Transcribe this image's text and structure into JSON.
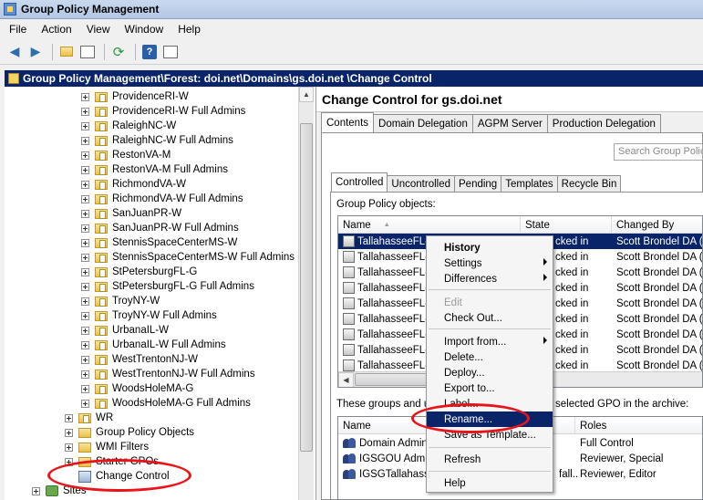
{
  "window": {
    "title": "Group Policy Management"
  },
  "menubar": [
    "File",
    "Action",
    "View",
    "Window",
    "Help"
  ],
  "toolbar": {
    "icons": [
      "back-arrow-icon",
      "forward-arrow-icon",
      "up-folder-icon",
      "show-hide-tree-icon",
      "refresh-icon",
      "help-icon",
      "properties-icon"
    ]
  },
  "path": "Group Policy Management\\Forest: doi.net\\Domains\\gs.doi.net \\Change Control",
  "tree": {
    "items": [
      {
        "label": "ProvidenceRI-W",
        "level": 2,
        "icon": "folder"
      },
      {
        "label": "ProvidenceRI-W Full Admins",
        "level": 2,
        "icon": "folder"
      },
      {
        "label": "RaleighNC-W",
        "level": 2,
        "icon": "folder"
      },
      {
        "label": "RaleighNC-W Full Admins",
        "level": 2,
        "icon": "folder"
      },
      {
        "label": "RestonVA-M",
        "level": 2,
        "icon": "folder"
      },
      {
        "label": "RestonVA-M Full Admins",
        "level": 2,
        "icon": "folder"
      },
      {
        "label": "RichmondVA-W",
        "level": 2,
        "icon": "folder"
      },
      {
        "label": "RichmondVA-W Full Admins",
        "level": 2,
        "icon": "folder"
      },
      {
        "label": "SanJuanPR-W",
        "level": 2,
        "icon": "folder"
      },
      {
        "label": "SanJuanPR-W Full Admins",
        "level": 2,
        "icon": "folder"
      },
      {
        "label": "StennisSpaceCenterMS-W",
        "level": 2,
        "icon": "folder"
      },
      {
        "label": "StennisSpaceCenterMS-W Full Admins",
        "level": 2,
        "icon": "folder"
      },
      {
        "label": "StPetersburgFL-G",
        "level": 2,
        "icon": "folder"
      },
      {
        "label": "StPetersburgFL-G Full Admins",
        "level": 2,
        "icon": "folder"
      },
      {
        "label": "TroyNY-W",
        "level": 2,
        "icon": "folder"
      },
      {
        "label": "TroyNY-W Full Admins",
        "level": 2,
        "icon": "folder"
      },
      {
        "label": "UrbanaIL-W",
        "level": 2,
        "icon": "folder"
      },
      {
        "label": "UrbanaIL-W Full Admins",
        "level": 2,
        "icon": "folder"
      },
      {
        "label": "WestTrentonNJ-W",
        "level": 2,
        "icon": "folder"
      },
      {
        "label": "WestTrentonNJ-W Full Admins",
        "level": 2,
        "icon": "folder"
      },
      {
        "label": "WoodsHoleMA-G",
        "level": 2,
        "icon": "folder"
      },
      {
        "label": "WoodsHoleMA-G Full Admins",
        "level": 2,
        "icon": "folder"
      },
      {
        "label": "WR",
        "level": 1,
        "icon": "folder"
      },
      {
        "label": "Group Policy Objects",
        "level": 1,
        "icon": "folder"
      },
      {
        "label": "WMI Filters",
        "level": 1,
        "icon": "folder"
      },
      {
        "label": "Starter GPOs",
        "level": 1,
        "icon": "folder"
      },
      {
        "label": "Change Control",
        "level": 1,
        "icon": "change-control"
      },
      {
        "label": "Sites",
        "level": 0,
        "icon": "sites"
      }
    ]
  },
  "right": {
    "header": "Change Control for gs.doi.net",
    "tabs": [
      "Contents",
      "Domain Delegation",
      "AGPM Server",
      "Production Delegation"
    ],
    "search_placeholder": "Search Group Policy",
    "subtabs": [
      "Controlled",
      "Uncontrolled",
      "Pending",
      "Templates",
      "Recycle Bin"
    ],
    "gpo_label": "Group Policy objects:",
    "gpo_columns": [
      "Name",
      "State",
      "Changed By"
    ],
    "gpo_rows": [
      {
        "name": "TallahasseeFL-S",
        "state": "cked in",
        "changed_by": "Scott Brondel DA (s"
      },
      {
        "name": "TallahasseeFL-S",
        "state": "cked in",
        "changed_by": "Scott Brondel DA (s"
      },
      {
        "name": "TallahasseeFL-S",
        "state": "cked in",
        "changed_by": "Scott Brondel DA (s"
      },
      {
        "name": "TallahasseeFL-S",
        "state": "cked in",
        "changed_by": "Scott Brondel DA (s"
      },
      {
        "name": "TallahasseeFL-S",
        "state": "cked in",
        "changed_by": "Scott Brondel DA (s"
      },
      {
        "name": "TallahasseeFL-S",
        "state": "cked in",
        "changed_by": "Scott Brondel DA (s"
      },
      {
        "name": "TallahasseeFL-S",
        "state": "cked in",
        "changed_by": "Scott Brondel DA (s"
      },
      {
        "name": "TallahasseeFL-S",
        "state": "cked in",
        "changed_by": "Scott Brondel DA (s"
      },
      {
        "name": "TallahasseeFL-S",
        "state": "cked in",
        "changed_by": "Scott Brondel DA (s"
      }
    ],
    "groups_label_left": "These groups and us",
    "groups_label_right": "selected GPO in the archive:",
    "groups_columns": [
      "Name",
      "Roles"
    ],
    "groups_rows": [
      {
        "name": "Domain Admins",
        "mid": "",
        "role": "Full Control"
      },
      {
        "name": "IGSGOU Admins",
        "mid": "",
        "role": "Reviewer, Special"
      },
      {
        "name": "IGSGTallahasse",
        "mid": "fall...",
        "role": "Reviewer, Editor"
      }
    ]
  },
  "context_menu": {
    "items": [
      {
        "label": "History",
        "style": "bold"
      },
      {
        "label": "Settings",
        "submenu": true
      },
      {
        "label": "Differences",
        "submenu": true
      },
      {
        "label": "Edit",
        "style": "disabled"
      },
      {
        "label": "Check Out..."
      },
      {
        "label": "Import from...",
        "submenu": true
      },
      {
        "label": "Delete..."
      },
      {
        "label": "Deploy..."
      },
      {
        "label": "Export to..."
      },
      {
        "label": "Label..."
      },
      {
        "label": "Rename...",
        "style": "highlight"
      },
      {
        "label": "Save as Template..."
      },
      {
        "label": "Refresh"
      },
      {
        "label": "Help"
      }
    ]
  },
  "colors": {
    "selection": "#0a246a",
    "annotation": "#e8141a",
    "folder": "#f0cf6a"
  }
}
